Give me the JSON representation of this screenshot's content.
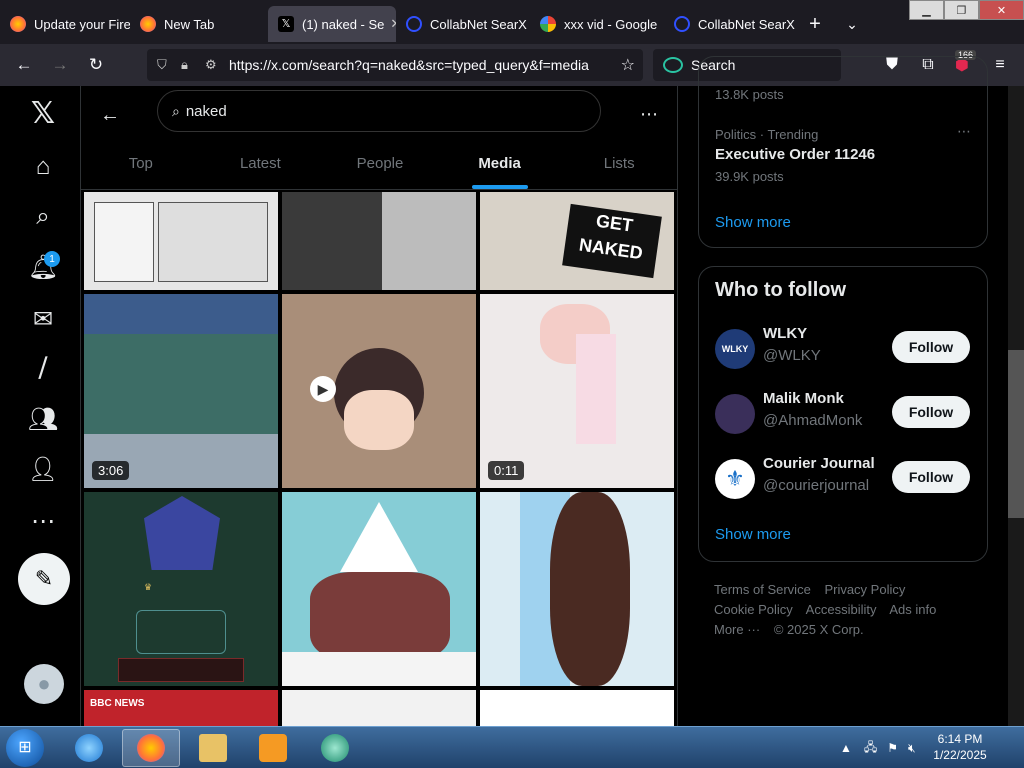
{
  "browser": {
    "tabs": [
      {
        "label": "Update your Fire",
        "icon": "firefox-icon",
        "color": "#ff7139"
      },
      {
        "label": "New Tab",
        "icon": "firefox-icon",
        "color": "#ff7139"
      },
      {
        "label": "(1) naked - Se",
        "icon": "x-logo-icon",
        "color": "#000000"
      },
      {
        "label": "CollabNet SearX",
        "icon": "searx-icon",
        "color": "#3050ff"
      },
      {
        "label": "xxx vid - Google",
        "icon": "google-icon",
        "color": "#4285f4"
      },
      {
        "label": "CollabNet SearX",
        "icon": "searx-icon",
        "color": "#3050ff"
      }
    ],
    "active_tab": 2,
    "url": "https://x.com/search?q=naked&src=typed_query&f=media",
    "search_placeholder": "Search",
    "extension_badge": "166"
  },
  "search": {
    "query": "naked",
    "tabs": [
      "Top",
      "Latest",
      "People",
      "Media",
      "Lists"
    ],
    "active_tab": "Media"
  },
  "nav": {
    "notifications_count": "1"
  },
  "media": [
    {
      "duration": "",
      "color": "#d9d9d9"
    },
    {
      "duration": "",
      "color": "#444444"
    },
    {
      "duration": "",
      "color": "#cfc9bf"
    },
    {
      "duration": "3:06",
      "color": "#3d6d66"
    },
    {
      "duration": "",
      "color": "#a98e79"
    },
    {
      "duration": "0:11",
      "color": "#e9e4e4"
    },
    {
      "duration": "",
      "color": "#1d3a2f"
    },
    {
      "duration": "",
      "color": "#7fc6cf"
    },
    {
      "duration": "",
      "color": "#d6eaf3"
    },
    {
      "duration": "",
      "color": "#c0232b",
      "label": "BBC NEWS"
    },
    {
      "duration": "",
      "color": "#f2f2f2"
    },
    {
      "duration": "",
      "color": "#ffffff"
    }
  ],
  "trends": {
    "top_posts": "13.8K posts",
    "category": "Politics · Trending",
    "title": "Executive Order 11246",
    "posts": "39.9K posts",
    "show_more": "Show more"
  },
  "who_to_follow": {
    "title": "Who to follow",
    "users": [
      {
        "name": "WLKY",
        "handle": "@WLKY",
        "avatar_color": "#1f3b77",
        "button": "Follow"
      },
      {
        "name": "Malik Monk",
        "handle": "@AhmadMonk",
        "avatar_color": "#3a2f5a",
        "button": "Follow"
      },
      {
        "name": "Courier Journal",
        "handle": "@courierjournal",
        "avatar_color": "#1a70c8",
        "button": "Follow"
      }
    ],
    "show_more": "Show more"
  },
  "footer": {
    "links": [
      "Terms of Service",
      "Privacy Policy",
      "Cookie Policy",
      "Accessibility",
      "Ads info",
      "More ···"
    ],
    "copyright": "© 2025 X Corp."
  },
  "taskbar": {
    "time": "6:14 PM",
    "date": "1/22/2025"
  }
}
